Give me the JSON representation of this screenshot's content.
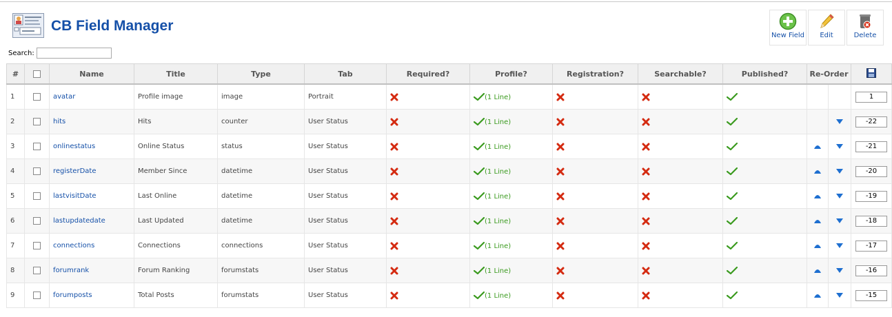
{
  "header": {
    "title": "CB Field Manager"
  },
  "toolbar": {
    "new_label": "New Field",
    "edit_label": "Edit",
    "delete_label": "Delete"
  },
  "search": {
    "label": "Search:",
    "value": ""
  },
  "columns": [
    "#",
    "",
    "Name",
    "Title",
    "Type",
    "Tab",
    "Required?",
    "Profile?",
    "Registration?",
    "Searchable?",
    "Published?",
    "Re-Order",
    "",
    ""
  ],
  "profile_text": "(1 Line)",
  "colors": {
    "title": "#1550a8",
    "link": "#1550a8",
    "special_type": "#c00000",
    "check": "#3a9a1e",
    "cross": "#d42a10"
  },
  "rows": [
    {
      "num": "1",
      "name": "avatar",
      "title": "Profile image",
      "type": "image",
      "tab": "Portrait",
      "order": "1",
      "up": false,
      "down": false
    },
    {
      "num": "2",
      "name": "hits",
      "title": "Hits",
      "type": "counter",
      "tab": "User Status",
      "order": "-22",
      "up": false,
      "down": true
    },
    {
      "num": "3",
      "name": "onlinestatus",
      "title": "Online Status",
      "type": "status",
      "tab": "User Status",
      "order": "-21",
      "up": true,
      "down": true
    },
    {
      "num": "4",
      "name": "registerDate",
      "title": "Member Since",
      "type": "datetime",
      "tab": "User Status",
      "order": "-20",
      "up": true,
      "down": true
    },
    {
      "num": "5",
      "name": "lastvisitDate",
      "title": "Last Online",
      "type": "datetime",
      "tab": "User Status",
      "order": "-19",
      "up": true,
      "down": true
    },
    {
      "num": "6",
      "name": "lastupdatedate",
      "title": "Last Updated",
      "type": "datetime",
      "tab": "User Status",
      "order": "-18",
      "up": true,
      "down": true
    },
    {
      "num": "7",
      "name": "connections",
      "title": "Connections",
      "type": "connections",
      "tab": "User Status",
      "order": "-17",
      "up": true,
      "down": true,
      "special": true
    },
    {
      "num": "8",
      "name": "forumrank",
      "title": "Forum Ranking",
      "type": "forumstats",
      "tab": "User Status",
      "order": "-16",
      "up": true,
      "down": true,
      "special": true
    },
    {
      "num": "9",
      "name": "forumposts",
      "title": "Total Posts",
      "type": "forumstats",
      "tab": "User Status",
      "order": "-15",
      "up": true,
      "down": true,
      "special": true
    }
  ]
}
